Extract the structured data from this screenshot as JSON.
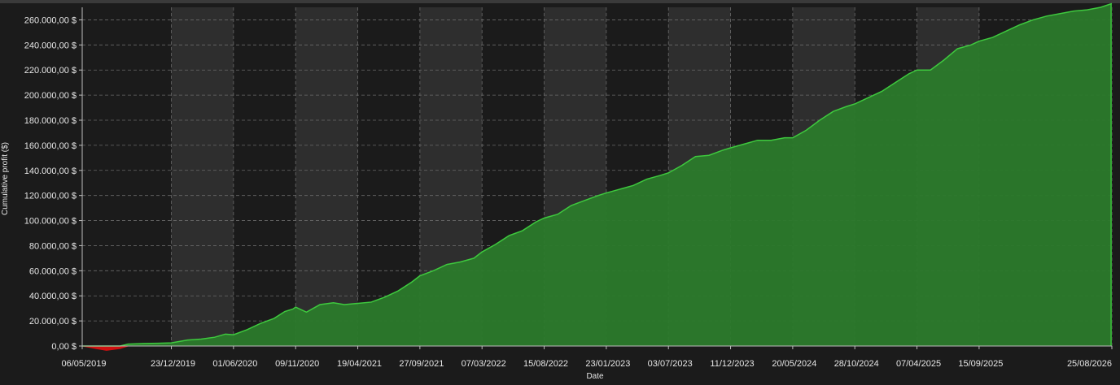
{
  "chart_data": {
    "type": "area",
    "xlabel": "Date",
    "ylabel": "Cumulative profit ($)",
    "ylim": [
      0,
      270000
    ],
    "y_ticks": [
      0,
      20000,
      40000,
      60000,
      80000,
      100000,
      120000,
      140000,
      160000,
      180000,
      200000,
      220000,
      240000,
      260000
    ],
    "y_tick_labels": [
      "0,00 $",
      "20.000,00 $",
      "40.000,00 $",
      "60.000,00 $",
      "80.000,00 $",
      "100.000,00 $",
      "120.000,00 $",
      "140.000,00 $",
      "160.000,00 $",
      "180.000,00 $",
      "200.000,00 $",
      "220.000,00 $",
      "240.000,00 $",
      "260.000,00 $"
    ],
    "x_tick_labels": [
      "06/05/2019",
      "23/12/2019",
      "01/06/2020",
      "09/11/2020",
      "19/04/2021",
      "27/09/2021",
      "07/03/2022",
      "15/08/2022",
      "23/01/2023",
      "03/07/2023",
      "11/12/2023",
      "20/05/2024",
      "28/10/2024",
      "07/04/2025",
      "15/09/2025",
      "25/08/2026"
    ],
    "x_dates": [
      "2019-05-06",
      "2019-12-23",
      "2020-06-01",
      "2020-11-09",
      "2021-04-19",
      "2021-09-27",
      "2022-03-07",
      "2022-08-15",
      "2023-01-23",
      "2023-07-03",
      "2023-12-11",
      "2024-05-20",
      "2024-10-28",
      "2025-04-07",
      "2025-09-15",
      "2026-08-25"
    ],
    "x_range": [
      "2019-05-06",
      "2026-08-25"
    ],
    "grid": true,
    "colors": {
      "positive_fill": "#2b7a2b",
      "positive_line": "#3ec93e",
      "negative": "#d01010",
      "band": "#2e2e2e",
      "background": "#1b1b1b"
    },
    "series": [
      {
        "x": [
          "2019-05-06",
          "2019-06-10",
          "2019-07-08",
          "2019-08-12",
          "2019-09-02",
          "2019-10-14",
          "2019-11-18",
          "2019-12-23",
          "2020-02-03",
          "2020-03-09",
          "2020-04-13",
          "2020-05-11",
          "2020-06-01",
          "2020-07-06",
          "2020-08-10",
          "2020-09-14",
          "2020-10-12",
          "2020-11-02",
          "2020-11-09",
          "2020-12-07",
          "2021-01-11",
          "2021-02-15",
          "2021-03-15",
          "2021-04-19",
          "2021-05-24",
          "2021-06-28",
          "2021-08-02",
          "2021-09-06",
          "2021-09-27",
          "2021-11-01",
          "2021-12-06",
          "2022-01-10",
          "2022-02-14",
          "2022-03-07",
          "2022-04-11",
          "2022-05-16",
          "2022-06-20",
          "2022-07-25",
          "2022-08-15",
          "2022-09-19",
          "2022-10-24",
          "2022-11-28",
          "2023-01-02",
          "2023-01-23",
          "2023-02-27",
          "2023-04-03",
          "2023-05-08",
          "2023-06-12",
          "2023-07-03",
          "2023-08-07",
          "2023-09-11",
          "2023-10-16",
          "2023-11-20",
          "2023-12-11",
          "2024-01-15",
          "2024-02-19",
          "2024-03-25",
          "2024-04-29",
          "2024-05-20",
          "2024-06-24",
          "2024-07-29",
          "2024-09-02",
          "2024-10-07",
          "2024-10-28",
          "2024-12-02",
          "2025-01-06",
          "2025-02-10",
          "2025-03-17",
          "2025-04-07",
          "2025-05-12",
          "2025-06-16",
          "2025-07-21",
          "2025-08-25",
          "2025-09-15",
          "2025-10-20",
          "2025-11-24",
          "2025-12-29",
          "2026-02-02",
          "2026-03-09",
          "2026-04-13",
          "2026-05-18",
          "2026-06-22",
          "2026-07-27",
          "2026-08-25"
        ],
        "values": [
          0,
          -2000,
          -3500,
          -2000,
          1500,
          2000,
          2200,
          2500,
          4800,
          5500,
          7000,
          9500,
          9000,
          13000,
          18000,
          22000,
          27500,
          29500,
          31000,
          27000,
          33000,
          34500,
          33000,
          34000,
          35000,
          39000,
          44000,
          51000,
          56000,
          60000,
          65000,
          67000,
          70000,
          75000,
          81000,
          88000,
          92000,
          99000,
          102000,
          105000,
          112000,
          116000,
          120000,
          122000,
          125000,
          128000,
          133000,
          136000,
          138000,
          144000,
          151000,
          152000,
          156000,
          158000,
          161000,
          164000,
          164000,
          166000,
          166000,
          172000,
          180000,
          187000,
          191000,
          193000,
          198000,
          203000,
          210000,
          217000,
          220000,
          220000,
          228000,
          237000,
          240000,
          243000,
          246000,
          251000,
          256000,
          260000,
          263000,
          265000,
          267000,
          268000,
          270000,
          273000
        ]
      }
    ]
  }
}
